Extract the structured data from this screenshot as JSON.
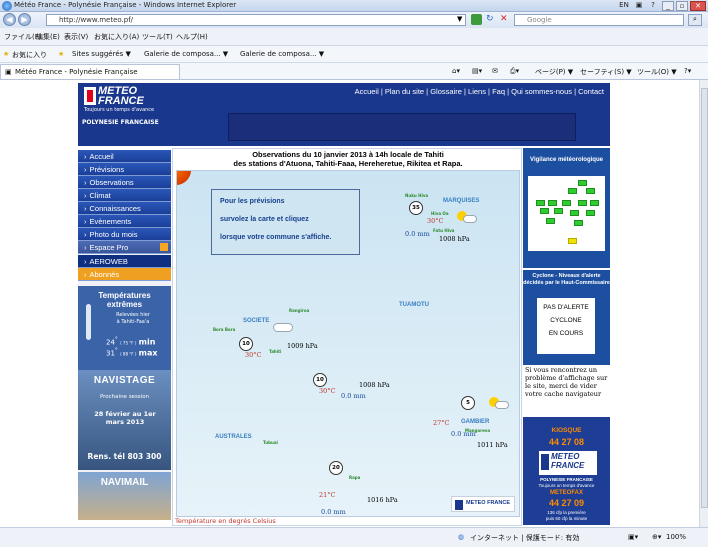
{
  "browser": {
    "window_title": "Météo France - Polynésie Française - Windows Internet Explorer",
    "lang": "EN",
    "url": "http://www.meteo.pf/",
    "search_placeholder": "Google",
    "menu": [
      "ファイル(F)",
      "編集(E)",
      "表示(V)",
      "お気に入り(A)",
      "ツール(T)",
      "ヘルプ(H)"
    ],
    "favorites": {
      "label": "お気に入り",
      "items": [
        "Sites suggérés ▼",
        "Galerie de composa... ▼",
        "Galerie de composa... ▼"
      ]
    },
    "tab_title": "Météo France - Polynésie Française",
    "toolbar_right": [
      "ページ(P) ▼",
      "セーフティ(S) ▼",
      "ツール(O) ▼"
    ],
    "status": {
      "zone": "インターネット | 保護モード: 有効",
      "zoom": "100%"
    }
  },
  "site": {
    "logo": {
      "line1": "METEO",
      "line2": "FRANCE",
      "tagline": "Toujours un temps d'avance"
    },
    "region": "POLYNESIE FRANCAISE",
    "topnav": [
      "Accueil",
      "Plan du site",
      "Glossaire",
      "Liens",
      "Faq",
      "Qui sommes-nous",
      "Contact"
    ],
    "leftnav": [
      "Accueil",
      "Prévisions",
      "Observations",
      "Climat",
      "Connaissances",
      "Evènements",
      "Photo du mois",
      "Espace Pro",
      "AEROWEB",
      "Abonnés"
    ],
    "temps": {
      "title1": "Températures",
      "title2": "extrêmes",
      "sub1": "Relevées hier",
      "sub2": "à Tahiti-Faa'a",
      "min_val": "24",
      "min_f": "( 75 °F )",
      "min_label": "min",
      "max_val": "31",
      "max_f": "( 88 °F )",
      "max_label": "max"
    },
    "navistage": {
      "title": "NAVISTAGE",
      "sub": "Prochaine session",
      "dates": "28 février au 1er mars 2013",
      "contact": "Rens. tél 803 300"
    },
    "navimail": {
      "title": "NAVIMAIL"
    }
  },
  "observations": {
    "title_line1": "Observations du 10 janvier 2013 à 14h locale de Tahiti",
    "title_line2": "des stations d'Atuona, Tahiti-Faaa, Hereheretue, Rikitea et Rapa.",
    "info": [
      "Pour les prévisions",
      "survolez la carte et cliquez",
      "lorsque votre commune s'affiche."
    ],
    "archipelagos": [
      "MARQUISES",
      "SOCIETE",
      "TUAMOTU",
      "AUSTRALES",
      "GAMBIER"
    ],
    "islands": [
      "Nuku Hiva",
      "Hiva Oa",
      "Fatu Hiva",
      "Rangiroa",
      "Bora Bora",
      "Tahiti",
      "Tubuai",
      "Mangareva",
      "Rapa"
    ],
    "stations": [
      {
        "name": "Atuona",
        "wind": "35",
        "temp": "30°C",
        "rain": "0.0 mm",
        "pressure": "1008 hPa"
      },
      {
        "name": "Tahiti-Faaa",
        "wind": "10",
        "temp": "30°C",
        "rain": "0.0 mm",
        "pressure": "1009 hPa"
      },
      {
        "name": "Hereheretue",
        "wind": "10",
        "temp": "30°C",
        "rain": "0.0 mm",
        "pressure": "1008 hPa"
      },
      {
        "name": "Rikitea",
        "wind": "5",
        "temp": "27°C",
        "rain": "0.0 mm",
        "pressure": "1011 hPa"
      },
      {
        "name": "Rapa",
        "wind": "20",
        "temp": "21°C",
        "rain": "0.0 mm",
        "pressure": "1016 hPa"
      }
    ],
    "map_logo": "METEO FRANCE",
    "temp_note": "Température en degrés Celsius"
  },
  "right": {
    "vigilance_title": "Vigilance météorologique",
    "cyclone_title": "Cyclone - Niveaux d'alerte décidés par le Haut-Commissaire",
    "cyclone_levels": [
      "PAS D'ALERTE",
      "CYCLONE",
      "EN COURS"
    ],
    "note": "Si vous rencontrez un problème d'affichage sur le site, merci de vider votre cache navigateur",
    "kiosque": {
      "label": "KIOSQUE",
      "phone": "44 27 08",
      "brand1": "METEO",
      "brand2": "FRANCE",
      "region": "POLYNESIE FRANCAISE",
      "tagline": "Toujours un temps d'avance",
      "fax_label": "METEOFAX",
      "fax_phone": "44 27 09",
      "price_line1": "136 cfp la première",
      "price_line2": "puis 60 cfp la minute"
    }
  }
}
